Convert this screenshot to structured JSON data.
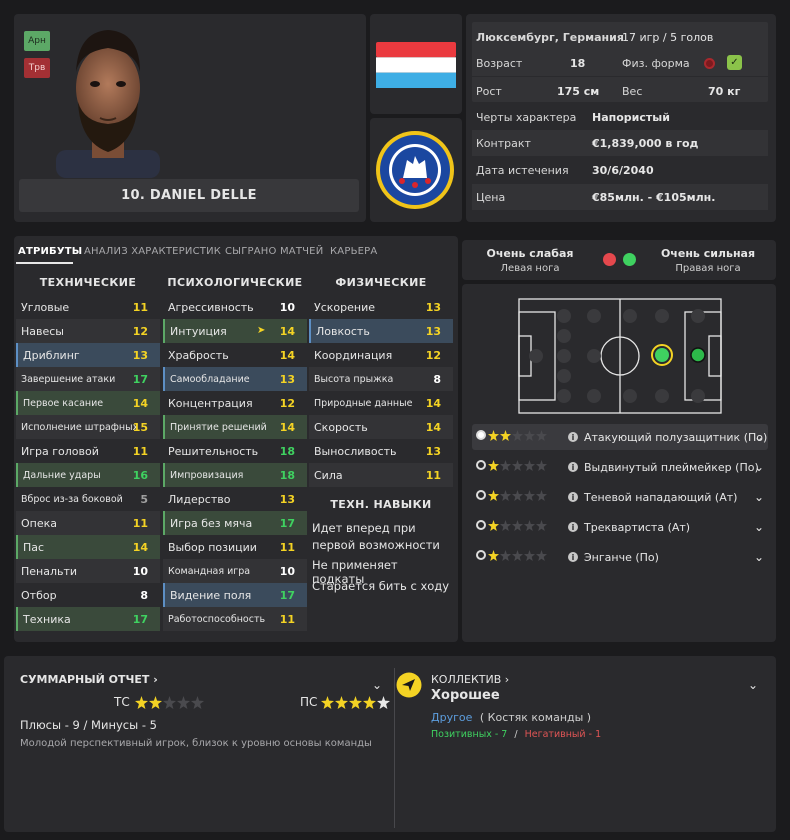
{
  "header": {
    "badge_top": "Арн",
    "badge_bottom": "Трв",
    "player_name": "10. DANIEL DELLE"
  },
  "info": {
    "nationality": "Люксембург, Германия",
    "caps": "17 игр / 5 голов",
    "age_label": "Возраст",
    "age": "18",
    "fitness_label": "Физ. форма",
    "height_label": "Рост",
    "height": "175 см",
    "weight_label": "Вес",
    "weight": "70 кг",
    "personality_label": "Черты характера",
    "personality": "Напористый",
    "contract_label": "Контракт",
    "contract": "€1,839,000 в год",
    "expiry_label": "Дата истечения",
    "expiry": "30/6/2040",
    "value_label": "Цена",
    "value": "€85млн. - €105млн."
  },
  "tabs": [
    "АТРИБУТЫ",
    "АНАЛИЗ ХАРАКТЕРИСТИК",
    "СЫГРАНО МАТЧЕЙ",
    "КАРЬЕРА"
  ],
  "columns": {
    "technical": "ТЕХНИЧЕСКИЕ",
    "mental": "ПСИХОЛОГИЧЕСКИЕ",
    "physical": "ФИЗИЧЕСКИЕ",
    "traits": "ТЕХН. НАВЫКИ"
  },
  "technical": [
    {
      "name": "Угловые",
      "value": "11"
    },
    {
      "name": "Навесы",
      "value": "12"
    },
    {
      "name": "Дриблинг",
      "value": "13"
    },
    {
      "name": "Завершение атаки",
      "value": "17"
    },
    {
      "name": "Первое касание",
      "value": "14"
    },
    {
      "name": "Исполнение штрафных",
      "value": "15"
    },
    {
      "name": "Игра головой",
      "value": "11"
    },
    {
      "name": "Дальние удары",
      "value": "16"
    },
    {
      "name": "Вброс из-за боковой",
      "value": "5"
    },
    {
      "name": "Опека",
      "value": "11"
    },
    {
      "name": "Пас",
      "value": "14"
    },
    {
      "name": "Пенальти",
      "value": "10"
    },
    {
      "name": "Отбор",
      "value": "8"
    },
    {
      "name": "Техника",
      "value": "17"
    }
  ],
  "mental": [
    {
      "name": "Агрессивность",
      "value": "10"
    },
    {
      "name": "Интуиция",
      "value": "14"
    },
    {
      "name": "Храбрость",
      "value": "14"
    },
    {
      "name": "Самообладание",
      "value": "13"
    },
    {
      "name": "Концентрация",
      "value": "12"
    },
    {
      "name": "Принятие решений",
      "value": "14"
    },
    {
      "name": "Решительность",
      "value": "18"
    },
    {
      "name": "Импровизация",
      "value": "18"
    },
    {
      "name": "Лидерство",
      "value": "13"
    },
    {
      "name": "Игра без мяча",
      "value": "17"
    },
    {
      "name": "Выбор позиции",
      "value": "11"
    },
    {
      "name": "Командная игра",
      "value": "10"
    },
    {
      "name": "Видение поля",
      "value": "17"
    },
    {
      "name": "Работоспособность",
      "value": "11"
    }
  ],
  "physical": [
    {
      "name": "Ускорение",
      "value": "13"
    },
    {
      "name": "Ловкость",
      "value": "13"
    },
    {
      "name": "Координация",
      "value": "12"
    },
    {
      "name": "Высота прыжка",
      "value": "8"
    },
    {
      "name": "Природные данные",
      "value": "14"
    },
    {
      "name": "Скорость",
      "value": "14"
    },
    {
      "name": "Выносливость",
      "value": "13"
    },
    {
      "name": "Сила",
      "value": "11"
    }
  ],
  "traits": [
    "Идет вперед при первой возможности",
    "Не применяет подкаты",
    "Старается бить с ходу"
  ],
  "feet": {
    "left_rating": "Очень слабая",
    "left_label": "Левая нога",
    "right_rating": "Очень сильная",
    "right_label": "Правая нога"
  },
  "roles": [
    {
      "name": "Атакующий полузащитник (По)",
      "stars": 2
    },
    {
      "name": "Выдвинутый плеймейкер (По)",
      "stars": 1.5
    },
    {
      "name": "Теневой нападающий (Ат)",
      "stars": 1.5
    },
    {
      "name": "Треквартиста (Ат)",
      "stars": 1.5
    },
    {
      "name": "Энганче (По)",
      "stars": 1.5
    }
  ],
  "report": {
    "title": "СУММАРНЫЙ ОТЧЕТ",
    "ca_label": "ТС",
    "ca_stars": 2,
    "pa_label": "ПС",
    "pa_stars": 4,
    "pros_cons": "Плюсы - 9 / Минусы - 5",
    "summary": "Молодой перспективный игрок, близок к уровню основы команды"
  },
  "team": {
    "title": "КОЛЛЕКТИВ",
    "status": "Хорошее",
    "group": "Другое",
    "group_role": "( Костяк команды )",
    "positive": "Позитивных - 7",
    "negative": "Негативный - 1"
  },
  "colors": {
    "accent_yellow": "#f4d324",
    "accent_green": "#3fd160",
    "negative_red": "#e05555",
    "link_blue": "#5d9ede"
  }
}
